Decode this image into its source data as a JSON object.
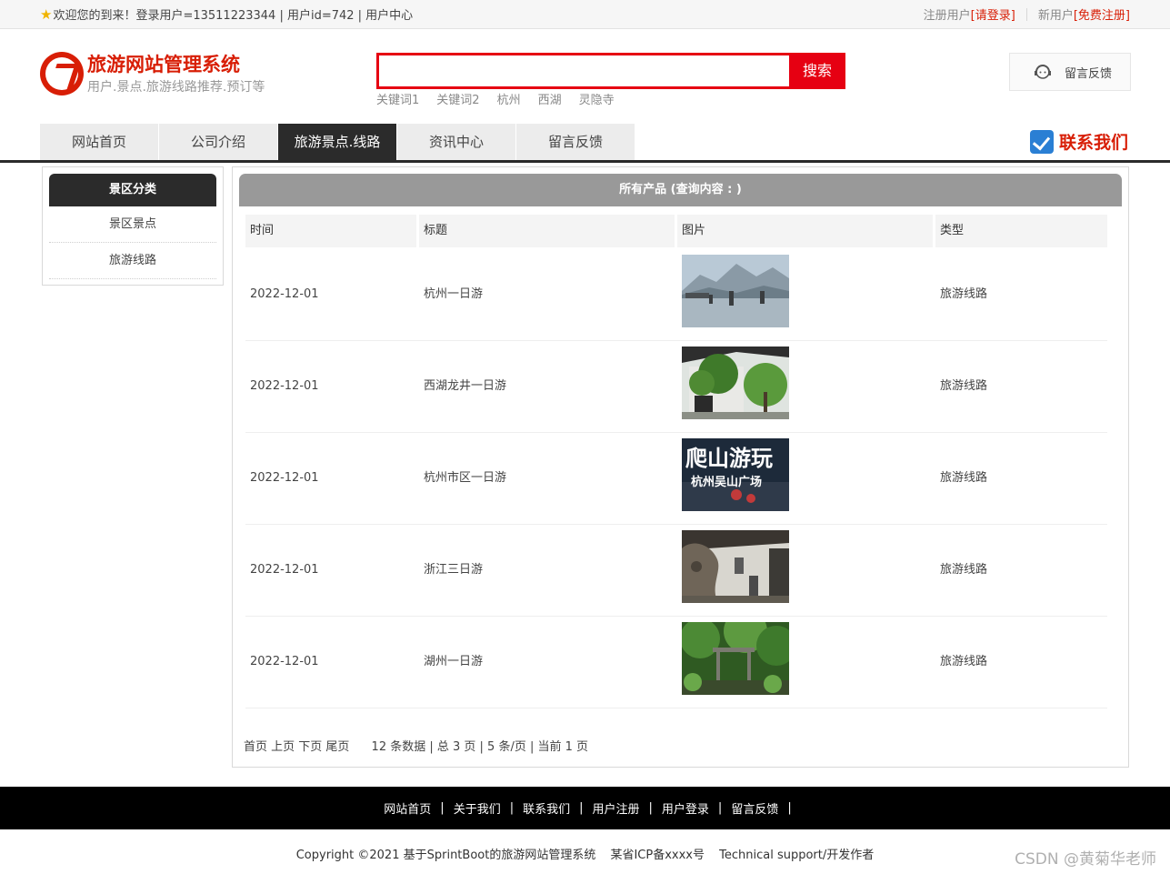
{
  "topbar": {
    "welcome": "欢迎您的到来！登录用户=13511223344 | 用户id=742 | 用户中心",
    "registered_label": "注册用户",
    "login_link": "[请登录]",
    "new_user_label": "新用户",
    "register_link": "[免费注册]"
  },
  "header": {
    "site_title": "旅游网站管理系统",
    "site_subtitle": "用户.景点.旅游线路推荐.预订等",
    "search_placeholder": "",
    "search_button": "搜索",
    "keywords": [
      "关键词1",
      "关键词2",
      "杭州",
      "西湖",
      "灵隐寺"
    ],
    "feedback_label": "留言反馈",
    "contact_label": "联系我们"
  },
  "nav": {
    "items": [
      "网站首页",
      "公司介绍",
      "旅游景点.线路",
      "资讯中心",
      "留言反馈"
    ],
    "active_index": 2
  },
  "sidebar": {
    "title": "景区分类",
    "items": [
      "景区景点",
      "旅游线路"
    ]
  },
  "content": {
    "title": "所有产品 (查询内容 : )",
    "columns": [
      "时间",
      "标题",
      "图片",
      "类型"
    ],
    "rows": [
      {
        "date": "2022-12-01",
        "title": "杭州一日游",
        "image": "lake-scene",
        "type": "旅游线路"
      },
      {
        "date": "2022-12-01",
        "title": "西湖龙井一日游",
        "image": "garden-gate",
        "type": "旅游线路"
      },
      {
        "date": "2022-12-01",
        "title": "杭州市区一日游",
        "image": "calligraphy-poster",
        "type": "旅游线路"
      },
      {
        "date": "2022-12-01",
        "title": "浙江三日游",
        "image": "rock-garden",
        "type": "旅游线路"
      },
      {
        "date": "2022-12-01",
        "title": "湖州一日游",
        "image": "forest-gate",
        "type": "旅游线路"
      }
    ],
    "poster_text_1": "爬山游玩",
    "poster_text_2": "杭州吴山广场",
    "pager": {
      "links": "首页 上页 下页 尾页",
      "summary": "12 条数据 | 总 3 页 | 5 条/页 | 当前 1 页"
    }
  },
  "footer": {
    "links": [
      "网站首页",
      "关于我们",
      "联系我们",
      "用户注册",
      "用户登录",
      "留言反馈"
    ],
    "copyright": "Copyright ©2021 基于SprintBoot的旅游网站管理系统",
    "icp": "某省ICP备xxxx号",
    "support": "Technical support/开发作者",
    "watermark": "CSDN @黄菊华老师"
  },
  "colors": {
    "brand_red": "#d81e06",
    "search_red": "#e60012",
    "nav_dark": "#2b2b2b",
    "content_head_gray": "#999999"
  }
}
